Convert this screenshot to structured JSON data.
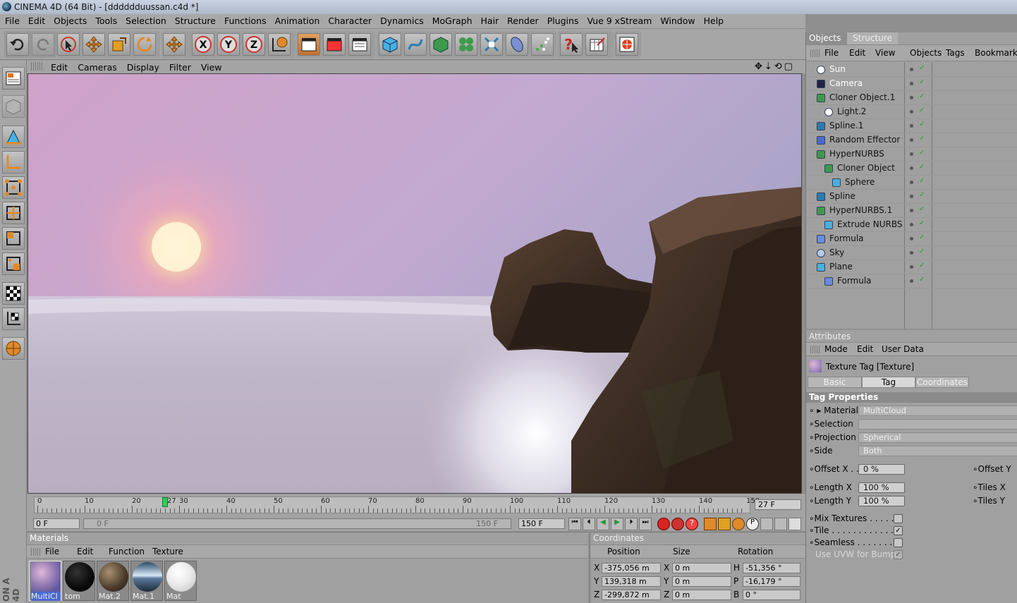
{
  "window": {
    "title": "CINEMA 4D (64 Bit) - [dddddduussan.c4d *]"
  },
  "menu": [
    "File",
    "Edit",
    "Objects",
    "Tools",
    "Selection",
    "Structure",
    "Functions",
    "Animation",
    "Character",
    "Dynamics",
    "MoGraph",
    "Hair",
    "Render",
    "Plugins",
    "Vue 9 xStream",
    "Window",
    "Help"
  ],
  "viewport_menu": [
    "Edit",
    "Cameras",
    "Display",
    "Filter",
    "View"
  ],
  "timeline": {
    "ticks": [
      "0",
      "10",
      "20",
      "30",
      "40",
      "50",
      "60",
      "70",
      "80",
      "90",
      "100",
      "110",
      "120",
      "130",
      "140",
      "150"
    ],
    "current_frame": "27",
    "frame_field": "27 F",
    "start_field": "0 F",
    "slider_start": "0 F",
    "slider_end": "150 F",
    "end_field": "150 F"
  },
  "materials": {
    "title": "Materials",
    "menu": [
      "File",
      "Edit",
      "Function",
      "Texture"
    ],
    "items": [
      {
        "label": "MultiCl"
      },
      {
        "label": "tom"
      },
      {
        "label": "Mat.2"
      },
      {
        "label": "Mat.1"
      },
      {
        "label": "Mat"
      }
    ]
  },
  "coordinates": {
    "title": "Coordinates",
    "headers": [
      "Position",
      "Size",
      "Rotation"
    ],
    "rows": [
      {
        "axis": "X",
        "pos": "-375,056 m",
        "size_axis": "X",
        "size": "0 m",
        "rot_axis": "H",
        "rot": "-51,356 °"
      },
      {
        "axis": "Y",
        "pos": "139,318 m",
        "size_axis": "Y",
        "size": "0 m",
        "rot_axis": "P",
        "rot": "-16,179 °"
      },
      {
        "axis": "Z",
        "pos": "-299,872 m",
        "size_axis": "Z",
        "size": "0 m",
        "rot_axis": "B",
        "rot": "0 °"
      }
    ]
  },
  "objects_panel": {
    "tabs": [
      "Objects",
      "Structure"
    ],
    "menu": [
      "File",
      "Edit",
      "View",
      "Objects",
      "Tags",
      "Bookmarks"
    ],
    "items": [
      {
        "name": "Sun",
        "indent": 0,
        "icon": "light-icon"
      },
      {
        "name": "Camera",
        "indent": 0,
        "icon": "camera-icon"
      },
      {
        "name": "Cloner Object.1",
        "indent": 0,
        "icon": "cloner-icon"
      },
      {
        "name": "Light.2",
        "indent": 1,
        "icon": "light-icon"
      },
      {
        "name": "Spline.1",
        "indent": 0,
        "icon": "spline-icon"
      },
      {
        "name": "Random Effector",
        "indent": 0,
        "icon": "effector-icon"
      },
      {
        "name": "HyperNURBS",
        "indent": 0,
        "icon": "hypernurbs-icon"
      },
      {
        "name": "Cloner Object",
        "indent": 1,
        "icon": "cloner-icon"
      },
      {
        "name": "Sphere",
        "indent": 2,
        "icon": "primitive-icon"
      },
      {
        "name": "Spline",
        "indent": 0,
        "icon": "spline-icon"
      },
      {
        "name": "HyperNURBS.1",
        "indent": 0,
        "icon": "hypernurbs-icon"
      },
      {
        "name": "Extrude NURBS",
        "indent": 1,
        "icon": "primitive-icon"
      },
      {
        "name": "Formula",
        "indent": 0,
        "icon": "formula-icon"
      },
      {
        "name": "Sky",
        "indent": 0,
        "icon": "sky-icon"
      },
      {
        "name": "Plane",
        "indent": 0,
        "icon": "primitive-icon"
      },
      {
        "name": "Formula",
        "indent": 1,
        "icon": "formula-icon"
      }
    ]
  },
  "attributes": {
    "title": "Attributes",
    "menu": [
      "Mode",
      "Edit",
      "User Data"
    ],
    "header": "Texture Tag [Texture]",
    "tabs": [
      "Basic",
      "Tag",
      "Coordinates"
    ],
    "section": "Tag Properties",
    "material_label": "Material",
    "material_value": "MultiCloud",
    "selection_label": "Selection",
    "selection_value": "",
    "projection_label": "Projection",
    "projection_value": "Spherical",
    "side_label": "Side",
    "side_value": "Both",
    "offset_x_label": "Offset X . .",
    "offset_x_value": "0 %",
    "offset_y_label": "Offset Y",
    "length_x_label": "Length X",
    "length_x_value": "100 %",
    "tiles_x_label": "Tiles X",
    "length_y_label": "Length Y",
    "length_y_value": "100 %",
    "tiles_y_label": "Tiles Y",
    "mix_label": "Mix Textures . . . . . .",
    "tile_label": "Tile . . . . . . . . . . . . .",
    "seamless_label": "Seamless . . . . . . . .",
    "uvw_label": "Use UVW for Bump"
  },
  "colors": {
    "panel": "#a0a0a0",
    "accent_orange": "#e08a2a",
    "active_tab": "#d8d8d8"
  }
}
